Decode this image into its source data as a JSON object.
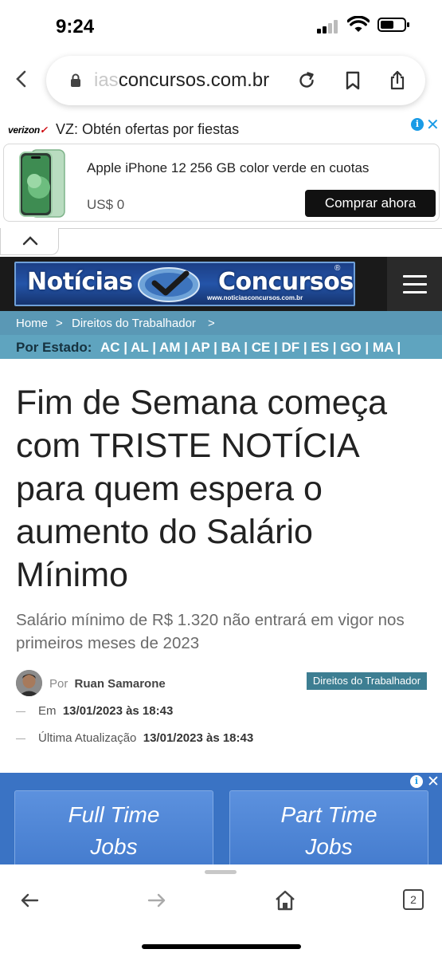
{
  "status_bar": {
    "time": "9:24"
  },
  "browser": {
    "url_faded": "ias",
    "url_main": "concursos.com.br",
    "open_tabs": "2"
  },
  "ad_top": {
    "brand": "verizon",
    "headline": "VZ: Obtén ofertas por fiestas",
    "product": "Apple iPhone 12 256 GB color verde en cuotas",
    "price": "US$ 0",
    "cta": "Comprar ahora",
    "adchoices_glyph": "i",
    "close_glyph": "✕"
  },
  "site": {
    "logo_left": "Notícias",
    "logo_right": "Concursos",
    "logo_url": "www.noticiasconcursos.com.br",
    "logo_reg": "®"
  },
  "breadcrumb": {
    "home": "Home",
    "separator": ">",
    "category": "Direitos do Trabalhador"
  },
  "states": {
    "label": "Por Estado:",
    "list": "AC | AL | AM | AP | BA | CE | DF | ES | GO | MA |"
  },
  "article": {
    "title": "Fim de Semana começa com TRISTE NOTÍCIA para quem espera o aumento do Salário Mínimo",
    "subtitle": "Salário mínimo de R$ 1.320 não entrará em vigor nos primeiros meses de 2023",
    "author_prefix": "Por",
    "author": "Ruan Samarone",
    "category_badge": "Direitos do Trabalhador",
    "published_label": "Em",
    "published": "13/01/2023 às 18:43",
    "updated_label": "Última Atualização",
    "updated": "13/01/2023 às 18:43"
  },
  "ad_bottom": {
    "left_line1": "Full Time",
    "left_line2": "Jobs",
    "right_line1": "Part Time",
    "right_line2": "Jobs",
    "adchoices_glyph": "i",
    "close_glyph": "✕"
  },
  "colors": {
    "breadcrumb_bg": "#5a98b5",
    "states_bg": "#5fa4bf",
    "badge_bg": "#3d7e92",
    "ad_bottom_bg": "#3a73c4"
  }
}
